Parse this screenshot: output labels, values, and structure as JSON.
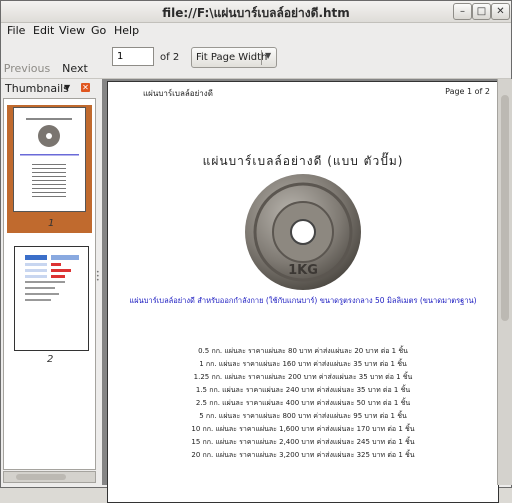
{
  "window": {
    "title": "file://F:\\แผ่นบาร์เบลล์อย่างดี.htm",
    "buttons": {
      "minimize": "–",
      "maximize": "□",
      "close": "✕"
    }
  },
  "menu": [
    "File",
    "Edit",
    "View",
    "Go",
    "Help"
  ],
  "toolbar": {
    "previous_label": "Previous",
    "next_label": "Next",
    "page_value": "1",
    "page_of": "of 2",
    "zoom": "Fit Page Width"
  },
  "sidebar": {
    "title": "Thumbnails",
    "thumbnails": [
      {
        "label": "1"
      },
      {
        "label": "2"
      }
    ]
  },
  "page": {
    "header_left": "แผ่นบาร์เบลล์อย่างดี",
    "header_right": "Page 1 of 2",
    "title": "แผ่นบาร์เบลล์อย่างดี (แบบ ตัวปั๊ม)",
    "description": "แผ่นบาร์เบลล์อย่างดี สำหรับออกกำลังกาย (ใช้กับแกนบาร์) ขนาดรูตรงกลาง 50 มิลลิเมตร (ขนาดมาตรฐาน)",
    "lines": [
      "0.5 กก. แผ่นละ ราคาแผ่นละ 80 บาท   ค่าส่งแผ่นละ 20 บาท ต่อ 1 ชิ้น",
      "1 กก. แผ่นละ ราคาแผ่นละ 160 บาท   ค่าส่งแผ่นละ 35 บาท ต่อ 1 ชิ้น",
      "1.25 กก. แผ่นละ ราคาแผ่นละ 200 บาท   ค่าส่งแผ่นละ 35 บาท ต่อ 1 ชิ้น",
      "1.5 กก. แผ่นละ ราคาแผ่นละ 240 บาท   ค่าส่งแผ่นละ 35 บาท ต่อ 1 ชิ้น",
      "2.5 กก. แผ่นละ ราคาแผ่นละ 400 บาท   ค่าส่งแผ่นละ 50 บาท ต่อ 1 ชิ้น",
      "5 กก. แผ่นละ ราคาแผ่นละ 800 บาท   ค่าส่งแผ่นละ 95 บาท ต่อ 1 ชิ้น",
      "10 กก. แผ่นละ ราคาแผ่นละ 1,600 บาท   ค่าส่งแผ่นละ 170 บาท ต่อ 1 ชิ้น",
      "15 กก. แผ่นละ ราคาแผ่นละ 2,400 บาท   ค่าส่งแผ่นละ 245 บาท ต่อ 1 ชิ้น",
      "20 กก. แผ่นละ ราคาแผ่นละ 3,200 บาท   ค่าส่งแผ่นละ 325 บาท ต่อ 1 ชิ้น"
    ],
    "plate_label": "1KG"
  },
  "colors": {
    "selection": "#c06a2e",
    "accent_next": "#f08a17",
    "link_text": "#1a1ac0"
  }
}
